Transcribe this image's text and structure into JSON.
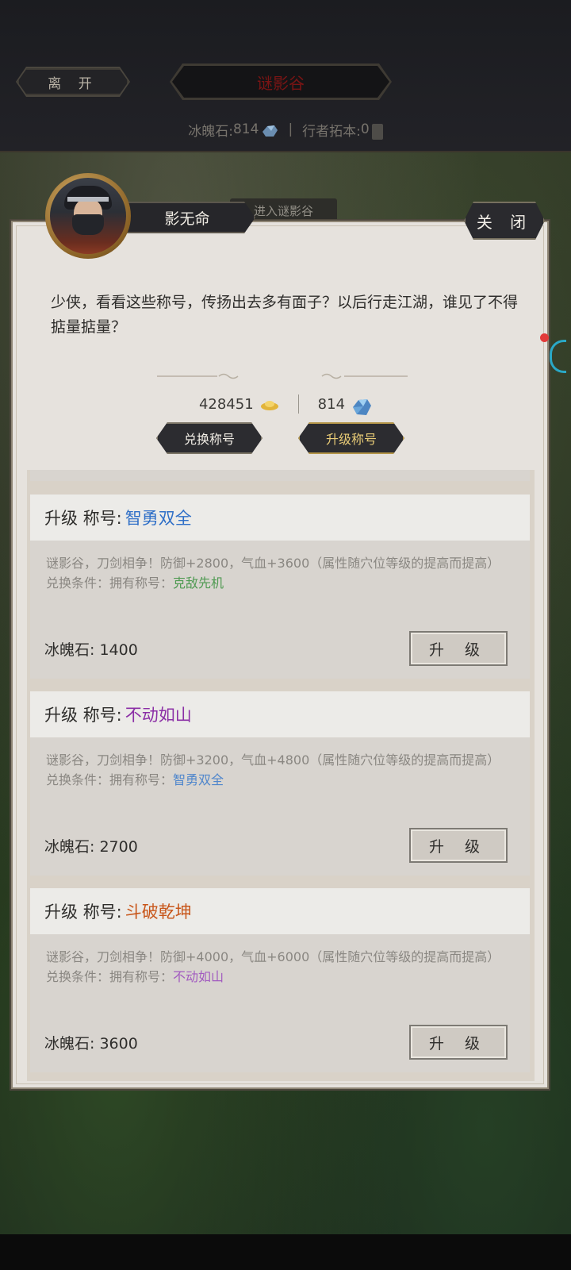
{
  "header": {
    "leave_label": "离 开",
    "location_title": "谜影谷",
    "ice_stone_label": "冰魄石:",
    "ice_stone_value": "814",
    "separator": "|",
    "rubbing_label": "行者拓本:",
    "rubbing_value": "0"
  },
  "background_tab": "进入谜影谷",
  "npc": {
    "name": "影无命",
    "close_label": "关 闭",
    "dialog": "少侠，看看这些称号，传扬出去多有面子？以后行走江湖，谁见了不得掂量掂量？"
  },
  "currency": {
    "gold": "428451",
    "ice_stone": "814"
  },
  "tabs": {
    "exchange": "兑换称号",
    "upgrade": "升级称号"
  },
  "titles": [
    {
      "prefix": "升级 称号:",
      "name": "智勇双全",
      "name_color": "#2f6fc7",
      "description": "谜影谷，刀剑相争！防御+2800，气血+3600（属性随穴位等级的提高而提高）",
      "condition_label": "兑换条件：拥有称号：",
      "condition_title": "克敌先机",
      "condition_color": "#4f9a52",
      "cost": "冰魄石: 1400",
      "button": "升 级"
    },
    {
      "prefix": "升级 称号:",
      "name": "不动如山",
      "name_color": "#8b2fa6",
      "description": "谜影谷，刀剑相争！防御+3200，气血+4800（属性随穴位等级的提高而提高）",
      "condition_label": "兑换条件：拥有称号：",
      "condition_title": "智勇双全",
      "condition_color": "#4f86cc",
      "cost": "冰魄石: 2700",
      "button": "升 级"
    },
    {
      "prefix": "升级 称号:",
      "name": "斗破乾坤",
      "name_color": "#c8561a",
      "description": "谜影谷，刀剑相争！防御+4000，气血+6000（属性随穴位等级的提高而提高）",
      "condition_label": "兑换条件：拥有称号：",
      "condition_title": "不动如山",
      "condition_color": "#a25cc0",
      "cost": "冰魄石: 3600",
      "button": "升 级"
    }
  ]
}
